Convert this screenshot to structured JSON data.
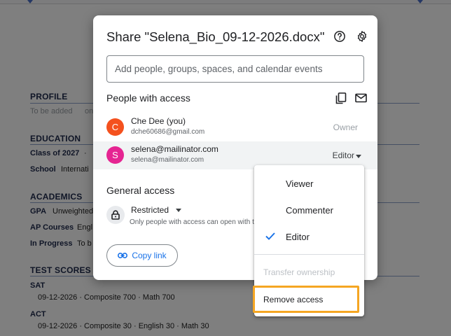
{
  "document": {
    "profile": {
      "heading": "PROFILE",
      "text": "To be added",
      "text_cut": "on"
    },
    "education": {
      "heading": "EDUCATION",
      "class_label": "Class of 2027",
      "class_sep": "·",
      "school_label": "School",
      "school_value": "Internati"
    },
    "academics": {
      "heading": "ACADEMICS",
      "gpa_label": "GPA",
      "gpa_value": "Unweighted",
      "ap_label": "AP Courses",
      "ap_value": "Engl",
      "progress_label": "In Progress",
      "progress_value": "To b"
    },
    "test_scores": {
      "heading": "TEST SCORES",
      "sat_label": "SAT",
      "sat_line": "09-12-2026  ·  Composite 700  ·  Math 700",
      "act_label": "ACT",
      "act_line": "09-12-2026  ·  Composite 30  ·  English 30  ·  Math 30"
    }
  },
  "dialog": {
    "title": "Share \"Selena_Bio_09-12-2026.docx\"",
    "help_icon": "help-icon",
    "settings_icon": "gear-icon",
    "add_placeholder": "Add people, groups, spaces, and calendar events",
    "people_heading": "People with access",
    "people": [
      {
        "initial": "C",
        "name": "Che Dee (you)",
        "email": "dche60686@gmail.com",
        "role": "Owner",
        "color": "#f4511e"
      },
      {
        "initial": "S",
        "name": "selena@mailinator.com",
        "email": "selena@mailinator.com",
        "role": "Editor",
        "color": "#e52592"
      }
    ],
    "general_heading": "General access",
    "access_level": "Restricted",
    "access_desc": "Only people with access can open with th",
    "copy_link": "Copy link"
  },
  "role_menu": {
    "items": [
      {
        "label": "Viewer",
        "checked": false
      },
      {
        "label": "Commenter",
        "checked": false
      },
      {
        "label": "Editor",
        "checked": true
      }
    ],
    "transfer": "Transfer ownership",
    "remove": "Remove access"
  },
  "colors": {
    "accent": "#1a73e8",
    "highlight": "#f5a623"
  }
}
